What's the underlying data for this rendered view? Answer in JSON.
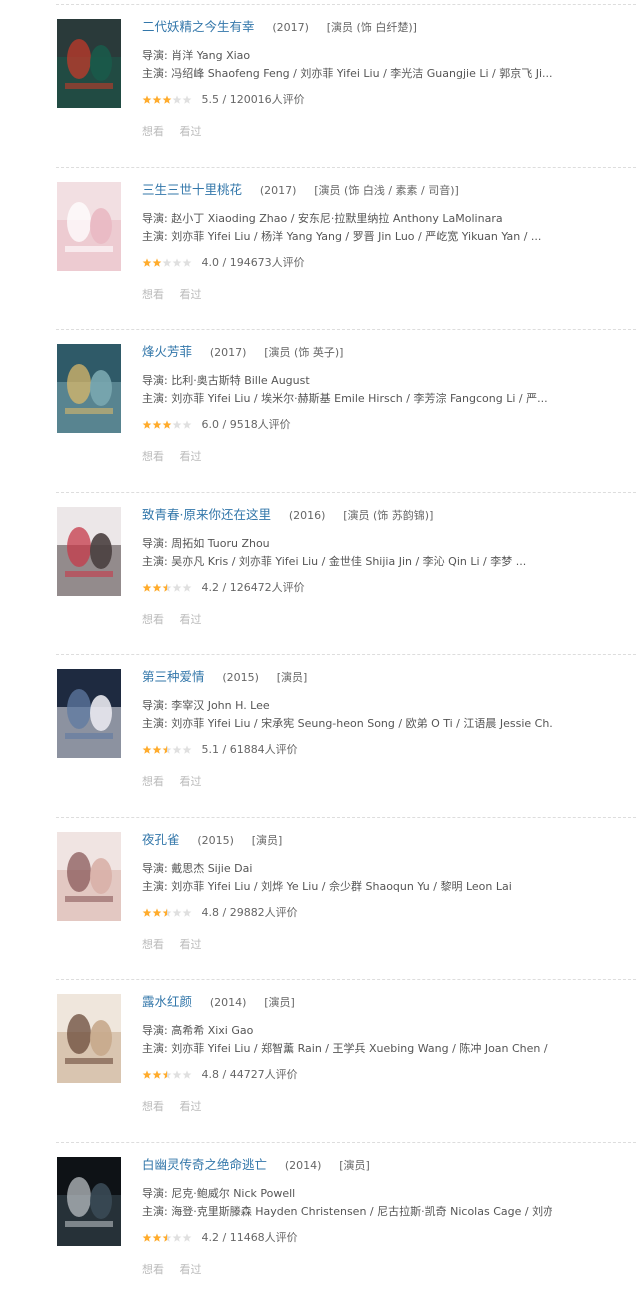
{
  "colors": {
    "link": "#3377aa",
    "star": "#ffac2d",
    "star_empty": "#e0e0e0",
    "muted": "#bbbbbb"
  },
  "actions": {
    "want": "想看",
    "seen": "看过"
  },
  "items": [
    {
      "title": "二代妖精之今生有幸",
      "year": "(2017)",
      "role": "[演员 (饰 白纤楚)]",
      "director": "导演: 肖洋 Yang Xiao",
      "cast": "主演: 冯绍峰 Shaofeng Feng / 刘亦菲 Yifei Liu / 李光洁 Guangjie Li / 郭京飞 Ji...",
      "stars": 3,
      "rating": "5.5 / 120016人评价",
      "poster_colors": [
        "#2a3a3a",
        "#1a5a4a",
        "#c23a2a"
      ]
    },
    {
      "title": "三生三世十里桃花",
      "year": "(2017)",
      "role": "[演员 (饰 白浅 / 素素 / 司音)]",
      "director": "导演: 赵小丁 Xiaoding Zhao / 安东尼·拉默里纳拉 Anthony LaMolinara",
      "cast": "主演: 刘亦菲 Yifei Liu / 杨洋 Yang Yang / 罗晋 Jin Luo / 严屹宽 Yikuan Yan / ...",
      "stars": 2,
      "rating": "4.0 / 194673人评价",
      "poster_colors": [
        "#f2dfe2",
        "#e9b9c3",
        "#ffffff"
      ]
    },
    {
      "title": "烽火芳菲",
      "year": "(2017)",
      "role": "[演员 (饰 英子)]",
      "director": "导演: 比利·奥古斯特 Bille August",
      "cast": "主演: 刘亦菲 Yifei Liu / 埃米尔·赫斯基 Emile Hirsch / 李芳淙 Fangcong Li / 严...",
      "stars": 3,
      "rating": "6.0 / 9518人评价",
      "poster_colors": [
        "#2f5a68",
        "#7aa7b0",
        "#d9b86a"
      ]
    },
    {
      "title": "致青春·原来你还在这里",
      "year": "(2016)",
      "role": "[演员 (饰 苏韵锦)]",
      "director": "导演: 周拓如 Tuoru Zhou",
      "cast": "主演: 吴亦凡 Kris / 刘亦菲 Yifei Liu / 金世佳 Shijia Jin / 李沁 Qin Li / 李梦 ...",
      "stars": 2.5,
      "rating": "4.2 / 126472人评价",
      "poster_colors": [
        "#ece7e8",
        "#4a3f3f",
        "#c63a4a"
      ]
    },
    {
      "title": "第三种爱情",
      "year": "(2015)",
      "role": "[演员]",
      "director": "导演: 李宰汉 John H. Lee",
      "cast": "主演: 刘亦菲 Yifei Liu / 宋承宪 Seung-heon Song / 欧弟 O Ti / 江语晨 Jessie Ch...",
      "stars": 2.5,
      "rating": "5.1 / 61884人评价",
      "poster_colors": [
        "#1e2a40",
        "#e8e8ee",
        "#5f7aa2"
      ]
    },
    {
      "title": "夜孔雀",
      "year": "(2015)",
      "role": "[演员]",
      "director": "导演: 戴思杰 Sijie Dai",
      "cast": "主演: 刘亦菲 Yifei Liu / 刘烨 Ye Liu / 佘少群 Shaoqun Yu / 黎明 Leon Lai",
      "stars": 2.5,
      "rating": "4.8 / 29882人评价",
      "poster_colors": [
        "#f0e4e2",
        "#d8b0a8",
        "#8a5a5a"
      ]
    },
    {
      "title": "露水红颜",
      "year": "(2014)",
      "role": "[演员]",
      "director": "导演: 高希希 Xixi Gao",
      "cast": "主演: 刘亦菲 Yifei Liu / 郑智薰 Rain / 王学兵 Xuebing Wang / 陈冲 Joan Chen / ...",
      "stars": 2.5,
      "rating": "4.8 / 44727人评价",
      "poster_colors": [
        "#efe6dc",
        "#c7a98c",
        "#6a4a3a"
      ]
    },
    {
      "title": "白幽灵传奇之绝命逃亡",
      "year": "(2014)",
      "role": "[演员]",
      "director": "导演: 尼克·鲍威尔 Nick Powell",
      "cast": "主演: 海登·克里斯滕森 Hayden Christensen / 尼古拉斯·凯奇 Nicolas Cage / 刘亦...",
      "stars": 2.5,
      "rating": "4.2 / 11468人评价",
      "poster_colors": [
        "#0e1216",
        "#3a4a55",
        "#b8bec2"
      ]
    }
  ]
}
